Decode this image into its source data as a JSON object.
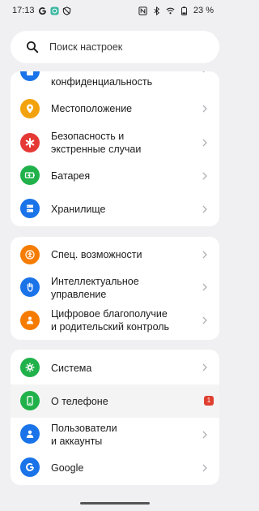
{
  "status": {
    "time": "17:13",
    "left_icons": [
      "google-g-icon",
      "app-notification-icon",
      "dnd-icon"
    ],
    "right_icons": [
      "nfc-icon",
      "bluetooth-icon",
      "wifi-icon",
      "battery-icon"
    ],
    "battery": "23 %"
  },
  "search": {
    "placeholder": "Поиск настроек",
    "icon": "search-icon"
  },
  "card1": {
    "items": [
      {
        "label": "конфиденциальность",
        "icon": "lock-icon",
        "color": "#1a73e8"
      },
      {
        "label": "Местоположение",
        "icon": "location-icon",
        "color": "#f2a20c"
      },
      {
        "label": "Безопасность и\nэкстренные случаи",
        "icon": "emergency-icon",
        "color": "#e53935"
      },
      {
        "label": "Батарея",
        "icon": "battery-charging-icon",
        "color": "#21b14b"
      },
      {
        "label": "Хранилище",
        "icon": "storage-icon",
        "color": "#1a73e8"
      }
    ]
  },
  "card2": {
    "items": [
      {
        "label": "Спец. возможности",
        "icon": "accessibility-icon",
        "color": "#f57c00"
      },
      {
        "label": "Интеллектуальное\nуправление",
        "icon": "hand-icon",
        "color": "#1a73e8"
      },
      {
        "label": "Цифровое благополучие\nи родительский контроль",
        "icon": "wellbeing-icon",
        "color": "#f57c00"
      }
    ]
  },
  "card3": {
    "items": [
      {
        "label": "Система",
        "icon": "system-gear-icon",
        "color": "#21b14b"
      },
      {
        "label": "О телефоне",
        "icon": "phone-icon",
        "color": "#21b14b",
        "badge": "1"
      },
      {
        "label": "Пользователи\nи аккаунты",
        "icon": "users-icon",
        "color": "#1a73e8"
      },
      {
        "label": "Google",
        "icon": "google-icon",
        "color": "#1a73e8"
      }
    ]
  }
}
